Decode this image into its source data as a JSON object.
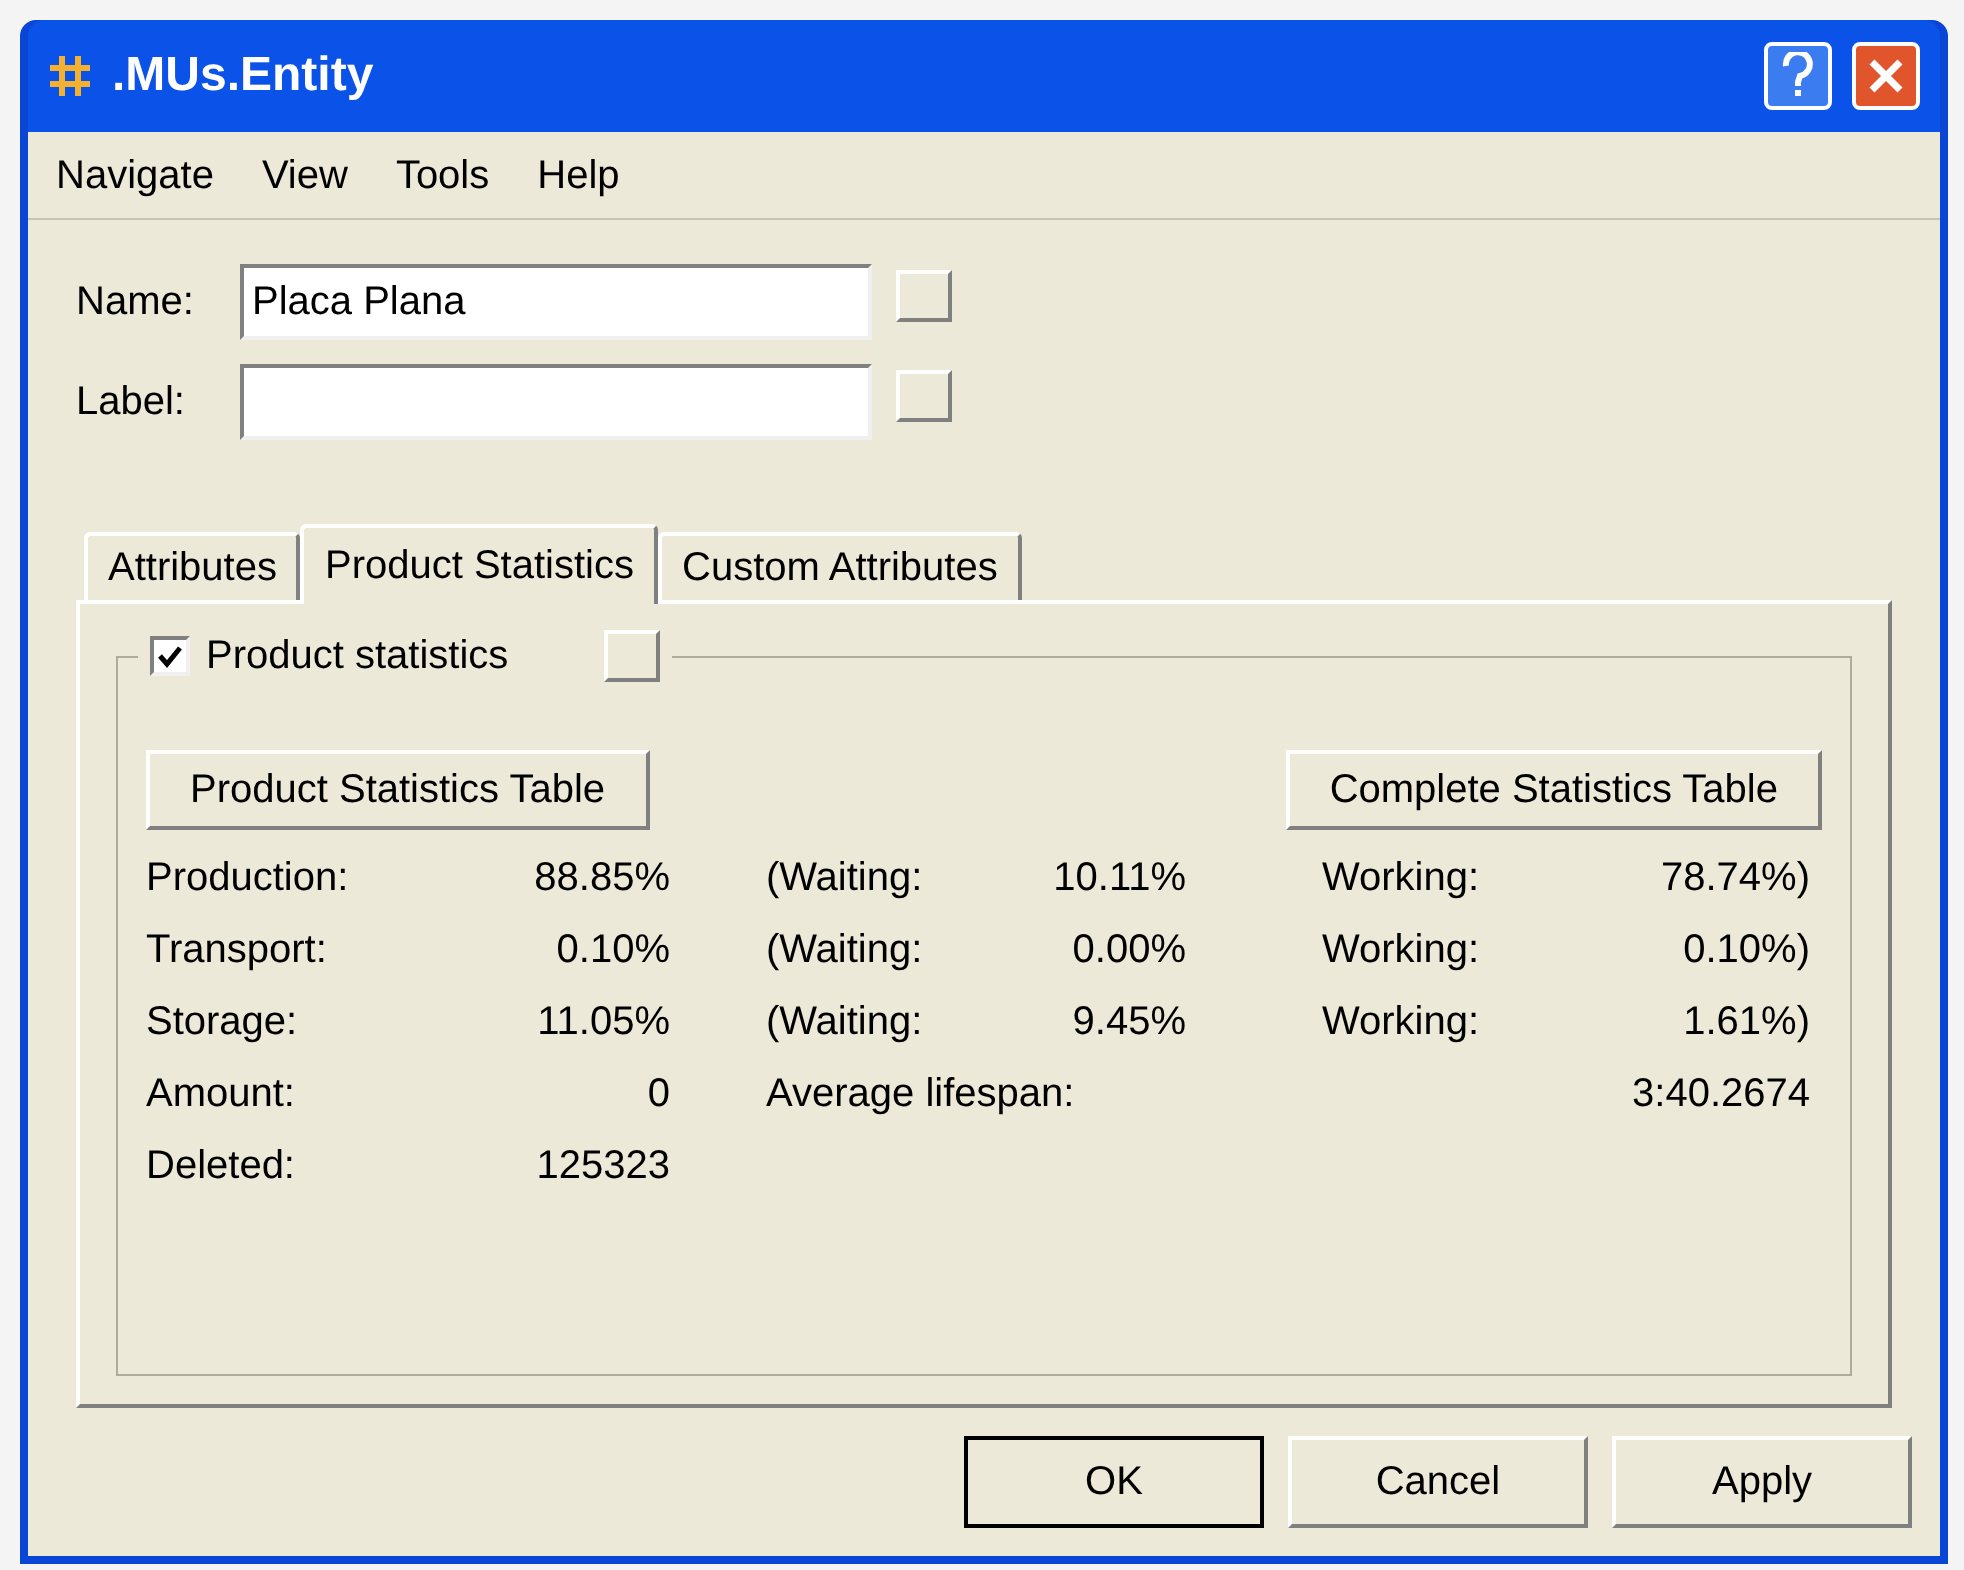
{
  "window": {
    "title": ".MUs.Entity"
  },
  "menu": [
    "Navigate",
    "View",
    "Tools",
    "Help"
  ],
  "fields": [
    {
      "label": "Name:",
      "value": "Placa Plana"
    },
    {
      "label": "Label:"
    }
  ],
  "tabs": [
    {
      "label": "Attributes",
      "selected": false
    },
    {
      "label": "Product Statistics",
      "selected": true
    },
    {
      "label": "Custom Attributes",
      "selected": false
    }
  ],
  "group": {
    "label": "Product statistics",
    "checked": true
  },
  "table_buttons": [
    "Product Statistics Table",
    "Complete Statistics Table"
  ],
  "stats": [
    {
      "kind": "breakdown",
      "label": "Production:",
      "value": "88.85%",
      "waiting_label": "(Waiting:",
      "waiting_value": "10.11%",
      "working_label": "Working:",
      "working_value": "78.74%)"
    },
    {
      "kind": "breakdown",
      "label": "Transport:",
      "value": "0.10%",
      "waiting_label": "(Waiting:",
      "waiting_value": "0.00%",
      "working_label": "Working:",
      "working_value": "0.10%)"
    },
    {
      "kind": "breakdown",
      "label": "Storage:",
      "value": "11.05%",
      "waiting_label": "(Waiting:",
      "waiting_value": "9.45%",
      "working_label": "Working:",
      "working_value": "1.61%)"
    },
    {
      "kind": "extra",
      "label": "Amount:",
      "value": "0",
      "extra_label": "Average lifespan:",
      "extra_value": "3:40.2674"
    },
    {
      "kind": "plain",
      "label": "Deleted:",
      "value": "125323"
    }
  ],
  "buttons": [
    {
      "label": "OK",
      "default": true
    },
    {
      "label": "Cancel",
      "default": false
    },
    {
      "label": "Apply",
      "default": false
    }
  ]
}
